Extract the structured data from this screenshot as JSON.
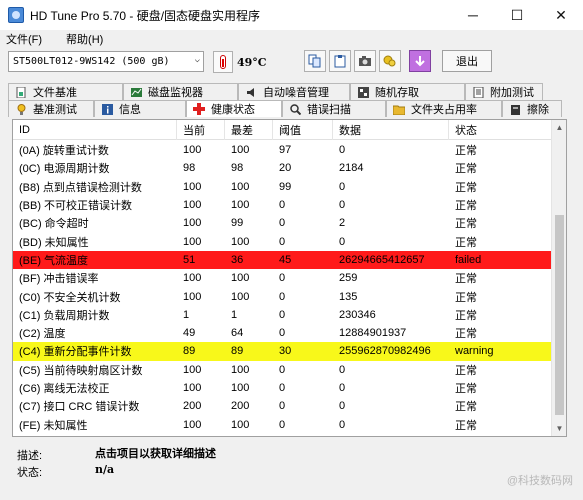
{
  "window": {
    "title": "HD Tune Pro 5.70 - 硬盘/固态硬盘实用程序",
    "minimize": "─",
    "maximize": "☐",
    "close": "✕"
  },
  "menu": {
    "file": "文件(F)",
    "help": "帮助(H)"
  },
  "toolbar": {
    "drive": "ST500LT012-9WS142 (500 gB)",
    "drive_arrow": "⌵",
    "temperature": "49°C",
    "exit_label": "退出"
  },
  "tabs_top": [
    {
      "label": "文件基准",
      "icon": "file-benchmark-icon"
    },
    {
      "label": "磁盘监视器",
      "icon": "disk-monitor-icon"
    },
    {
      "label": "自动噪音管理",
      "icon": "speaker-icon"
    },
    {
      "label": "随机存取",
      "icon": "random-access-icon"
    },
    {
      "label": "附加测试",
      "icon": "extra-tests-icon"
    }
  ],
  "tabs_bottom": [
    {
      "label": "基准测试",
      "icon": "benchmark-icon"
    },
    {
      "label": "信息",
      "icon": "info-icon"
    },
    {
      "label": "健康状态",
      "icon": "health-icon"
    },
    {
      "label": "错误扫描",
      "icon": "error-scan-icon"
    },
    {
      "label": "文件夹占用率",
      "icon": "folder-icon"
    },
    {
      "label": "擦除",
      "icon": "erase-icon"
    }
  ],
  "table": {
    "columns": [
      "ID",
      "当前",
      "最差",
      "阈值",
      "数据",
      "状态"
    ],
    "rows": [
      {
        "id": "(0A) 旋转重试计数",
        "cur": "100",
        "worst": "100",
        "thr": "97",
        "data": "0",
        "status": "正常",
        "state": "ok"
      },
      {
        "id": "(0C) 电源周期计数",
        "cur": "98",
        "worst": "98",
        "thr": "20",
        "data": "2184",
        "status": "正常",
        "state": "ok"
      },
      {
        "id": "(B8) 点到点错误检测计数",
        "cur": "100",
        "worst": "100",
        "thr": "99",
        "data": "0",
        "status": "正常",
        "state": "ok"
      },
      {
        "id": "(BB) 不可校正错误计数",
        "cur": "100",
        "worst": "100",
        "thr": "0",
        "data": "0",
        "status": "正常",
        "state": "ok"
      },
      {
        "id": "(BC) 命令超时",
        "cur": "100",
        "worst": "99",
        "thr": "0",
        "data": "2",
        "status": "正常",
        "state": "ok"
      },
      {
        "id": "(BD) 未知属性",
        "cur": "100",
        "worst": "100",
        "thr": "0",
        "data": "0",
        "status": "正常",
        "state": "ok"
      },
      {
        "id": "(BE) 气流温度",
        "cur": "51",
        "worst": "36",
        "thr": "45",
        "data": "26294665412657",
        "status": "failed",
        "state": "failed"
      },
      {
        "id": "(BF) 冲击错误率",
        "cur": "100",
        "worst": "100",
        "thr": "0",
        "data": "259",
        "status": "正常",
        "state": "ok"
      },
      {
        "id": "(C0) 不安全关机计数",
        "cur": "100",
        "worst": "100",
        "thr": "0",
        "data": "135",
        "status": "正常",
        "state": "ok"
      },
      {
        "id": "(C1) 负载周期计数",
        "cur": "1",
        "worst": "1",
        "thr": "0",
        "data": "230346",
        "status": "正常",
        "state": "ok"
      },
      {
        "id": "(C2) 温度",
        "cur": "49",
        "worst": "64",
        "thr": "0",
        "data": "12884901937",
        "status": "正常",
        "state": "ok"
      },
      {
        "id": "(C4) 重新分配事件计数",
        "cur": "89",
        "worst": "89",
        "thr": "30",
        "data": "255962870982496",
        "status": "warning",
        "state": "warning"
      },
      {
        "id": "(C5) 当前待映射扇区计数",
        "cur": "100",
        "worst": "100",
        "thr": "0",
        "data": "0",
        "status": "正常",
        "state": "ok"
      },
      {
        "id": "(C6) 离线无法校正",
        "cur": "100",
        "worst": "100",
        "thr": "0",
        "data": "0",
        "status": "正常",
        "state": "ok"
      },
      {
        "id": "(C7) 接口 CRC 错误计数",
        "cur": "200",
        "worst": "200",
        "thr": "0",
        "data": "0",
        "status": "正常",
        "state": "ok"
      },
      {
        "id": "(FE) 未知属性",
        "cur": "100",
        "worst": "100",
        "thr": "0",
        "data": "0",
        "status": "正常",
        "state": "ok"
      }
    ]
  },
  "details": {
    "desc_label": "描述:",
    "desc_value": "点击项目以获取详细描述",
    "status_label": "状态:",
    "status_value": "n/a"
  },
  "watermark": "@科技数码网"
}
